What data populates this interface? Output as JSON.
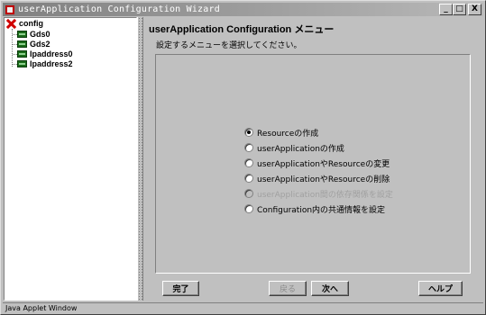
{
  "window": {
    "title": "userApplication Configuration Wizard",
    "controls": [
      "_",
      "□",
      "X"
    ]
  },
  "tree": {
    "root": {
      "label": "config",
      "icon": "red-x-icon"
    },
    "children": [
      {
        "label": "Gds0",
        "icon": "resource-icon"
      },
      {
        "label": "Gds2",
        "icon": "resource-icon"
      },
      {
        "label": "Ipaddress0",
        "icon": "resource-icon"
      },
      {
        "label": "Ipaddress2",
        "icon": "resource-icon"
      }
    ]
  },
  "content": {
    "title": "userApplication Configuration メニュー",
    "subtitle": "設定するメニューを選択してください。",
    "options": [
      {
        "label": "Resourceの作成",
        "checked": true,
        "enabled": true
      },
      {
        "label": "userApplicationの作成",
        "checked": false,
        "enabled": true
      },
      {
        "label": "userApplicationやResourceの変更",
        "checked": false,
        "enabled": true
      },
      {
        "label": "userApplicationやResourceの削除",
        "checked": false,
        "enabled": true
      },
      {
        "label": "userApplication間の依存関係を設定",
        "checked": false,
        "enabled": false
      },
      {
        "label": "Configuration内の共通情報を設定",
        "checked": false,
        "enabled": true
      }
    ]
  },
  "buttons": {
    "finish": "完了",
    "back": "戻る",
    "next": "次へ",
    "help": "ヘルプ"
  },
  "status": "Java Applet Window"
}
